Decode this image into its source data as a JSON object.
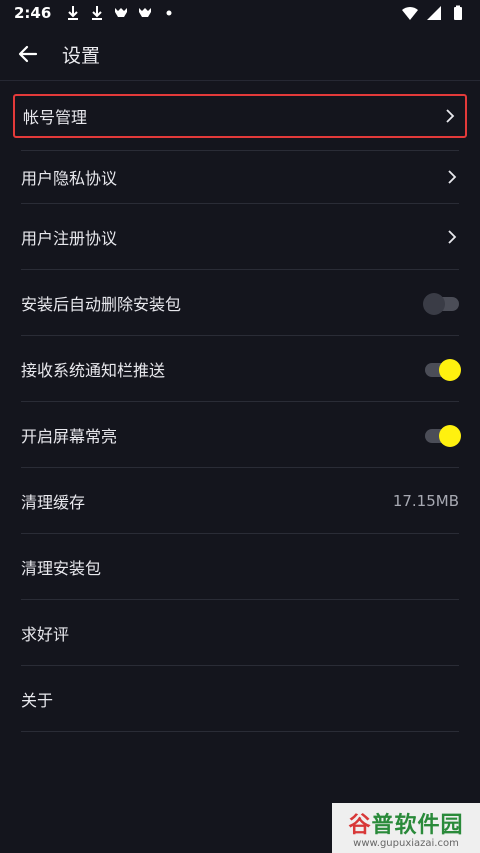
{
  "status_bar": {
    "time": "2:46",
    "left_icons": [
      "download-icon",
      "download-icon",
      "app-icon",
      "app-icon",
      "dot-icon"
    ],
    "right_icons": [
      "wifi-icon",
      "signal-icon",
      "battery-icon"
    ]
  },
  "header": {
    "title": "设置",
    "back_icon": "arrow-left-icon"
  },
  "colors": {
    "background": "#14151d",
    "highlight_border": "#e33a3a",
    "toggle_on": "#fff10f"
  },
  "settings": {
    "account": {
      "label": "帐号管理"
    },
    "privacy": {
      "label": "用户隐私协议"
    },
    "register": {
      "label": "用户注册协议"
    },
    "auto_delete": {
      "label": "安装后自动删除安装包",
      "enabled": false
    },
    "notify": {
      "label": "接收系统通知栏推送",
      "enabled": true
    },
    "screen_on": {
      "label": "开启屏幕常亮",
      "enabled": true
    },
    "clear_cache": {
      "label": "清理缓存",
      "value": "17.15MB"
    },
    "clear_packages": {
      "label": "清理安装包"
    },
    "rate": {
      "label": "求好评"
    },
    "about": {
      "label": "关于"
    }
  },
  "watermark": {
    "brand_red": "谷",
    "brand_green": "普软件园",
    "url": "www.gupuxiazai.com"
  }
}
